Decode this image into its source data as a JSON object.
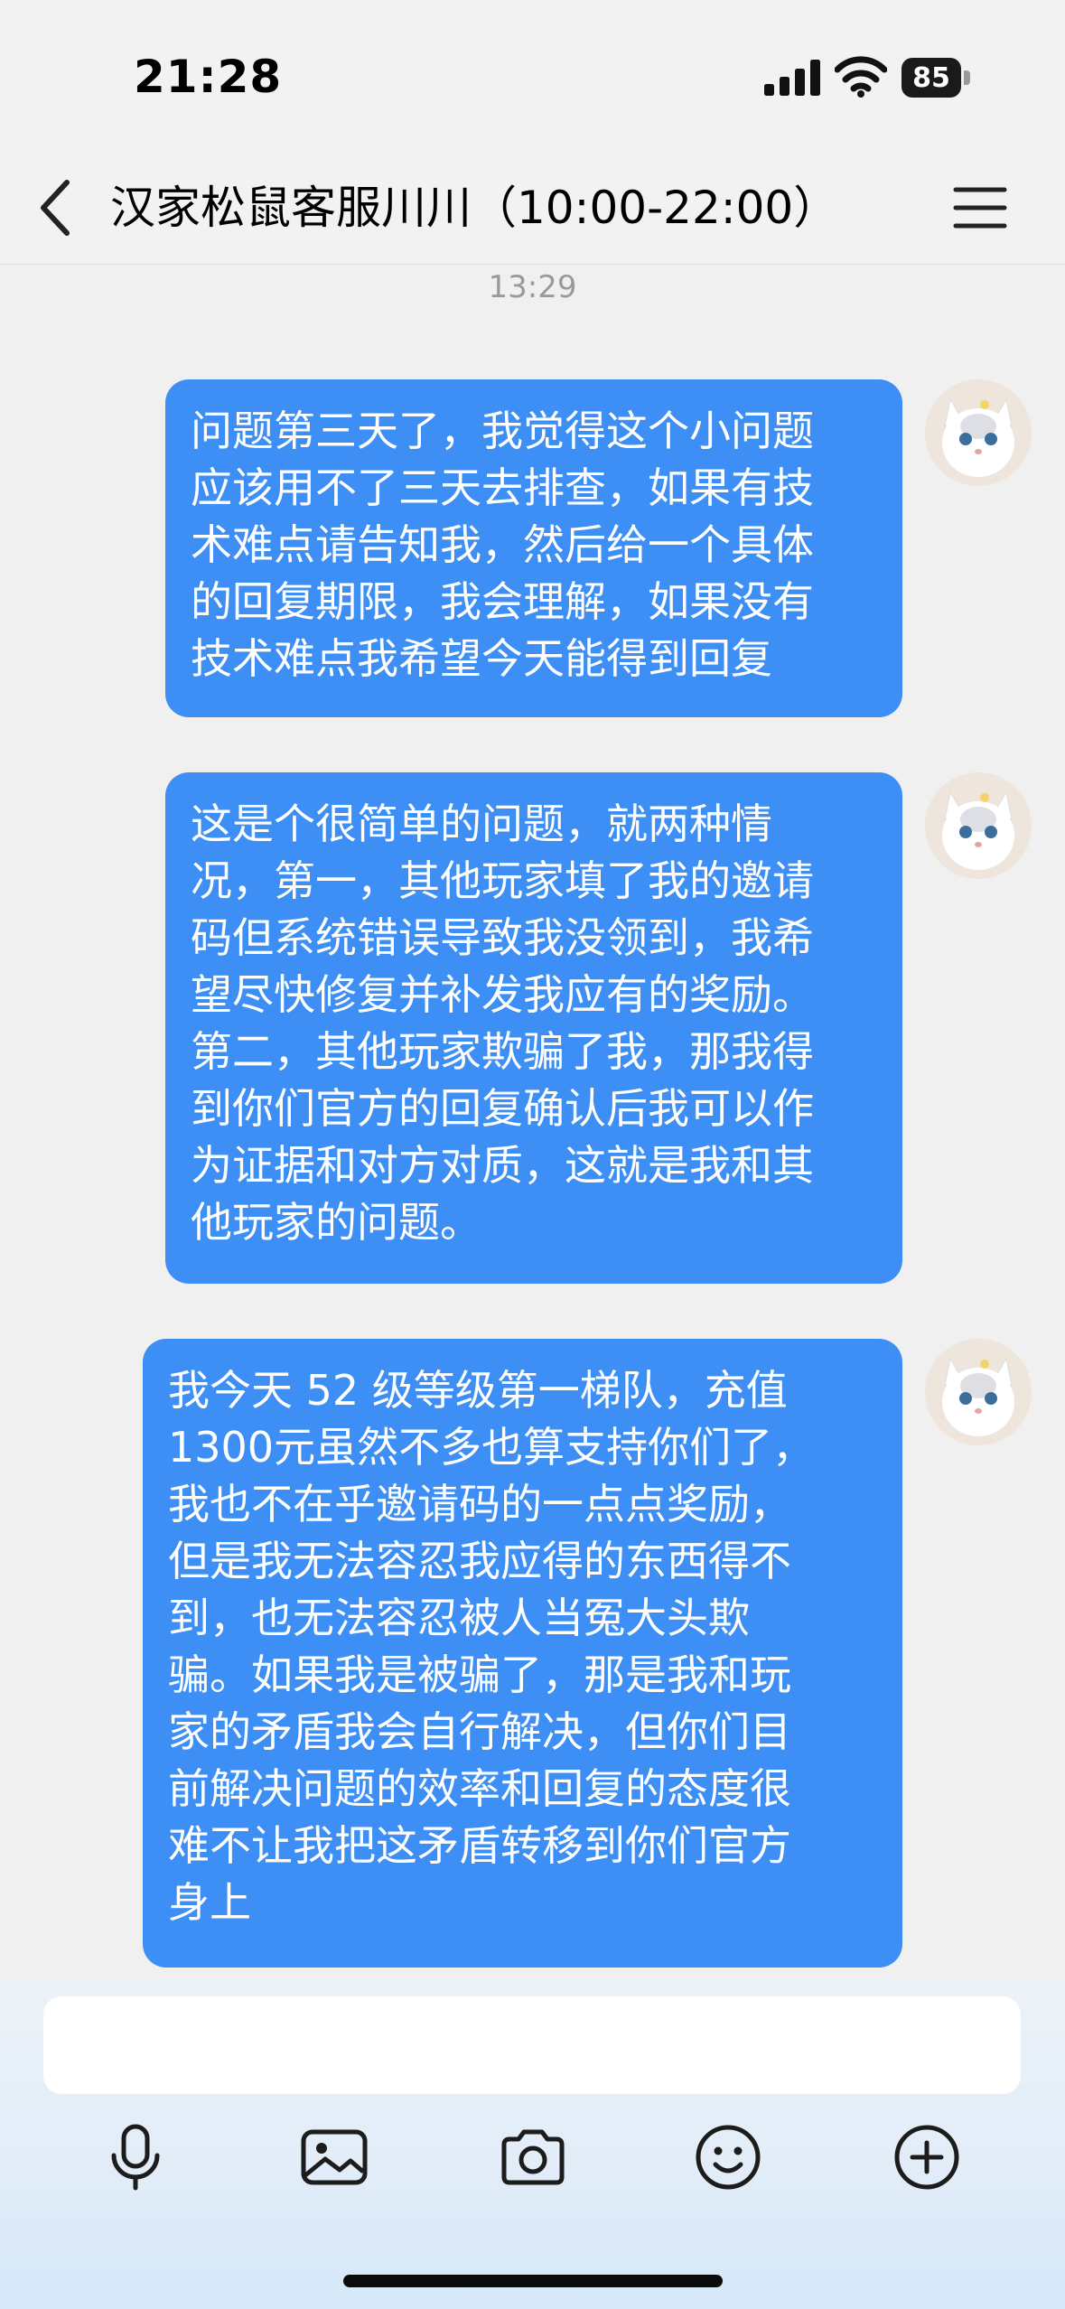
{
  "status_bar": {
    "time": "21:28",
    "battery": "85"
  },
  "header": {
    "title": "汉家松鼠客服川川（10:00-22:00）"
  },
  "timestamp": "13:29",
  "messages": [
    {
      "text": "问题第三天了，我觉得这个小问题\n应该用不了三天去排查，如果有技\n术难点请告知我，然后给一个具体\n的回复期限，我会理解，如果没有\n技术难点我希望今天能得到回复"
    },
    {
      "text": "这是个很简单的问题，就两种情\n况，第一，其他玩家填了我的邀请\n码但系统错误导致我没领到，我希\n望尽快修复并补发我应有的奖励。\n第二，其他玩家欺骗了我，那我得\n到你们官方的回复确认后我可以作\n为证据和对方对质，这就是我和其\n他玩家的问题。"
    },
    {
      "text": "我今天 52 级等级第一梯队，充值\n1300元虽然不多也算支持你们了，\n我也不在乎邀请码的一点点奖励，\n但是我无法容忍我应得的东西得不\n到，也无法容忍被人当冤大头欺\n骗。如果我是被骗了，那是我和玩\n家的矛盾我会自行解决，但你们目\n前解决问题的效率和回复的态度很\n难不让我把这矛盾转移到你们官方\n身上"
    }
  ],
  "input": {
    "value": ""
  },
  "icons": {
    "back": "chevron-left-icon",
    "menu": "hamburger-menu-icon",
    "voice": "microphone-icon",
    "image": "image-icon",
    "camera": "camera-icon",
    "emoji": "emoji-icon",
    "more": "plus-circle-icon"
  },
  "colors": {
    "bubble": "#3d8ff5",
    "background": "#f0f0f0"
  }
}
